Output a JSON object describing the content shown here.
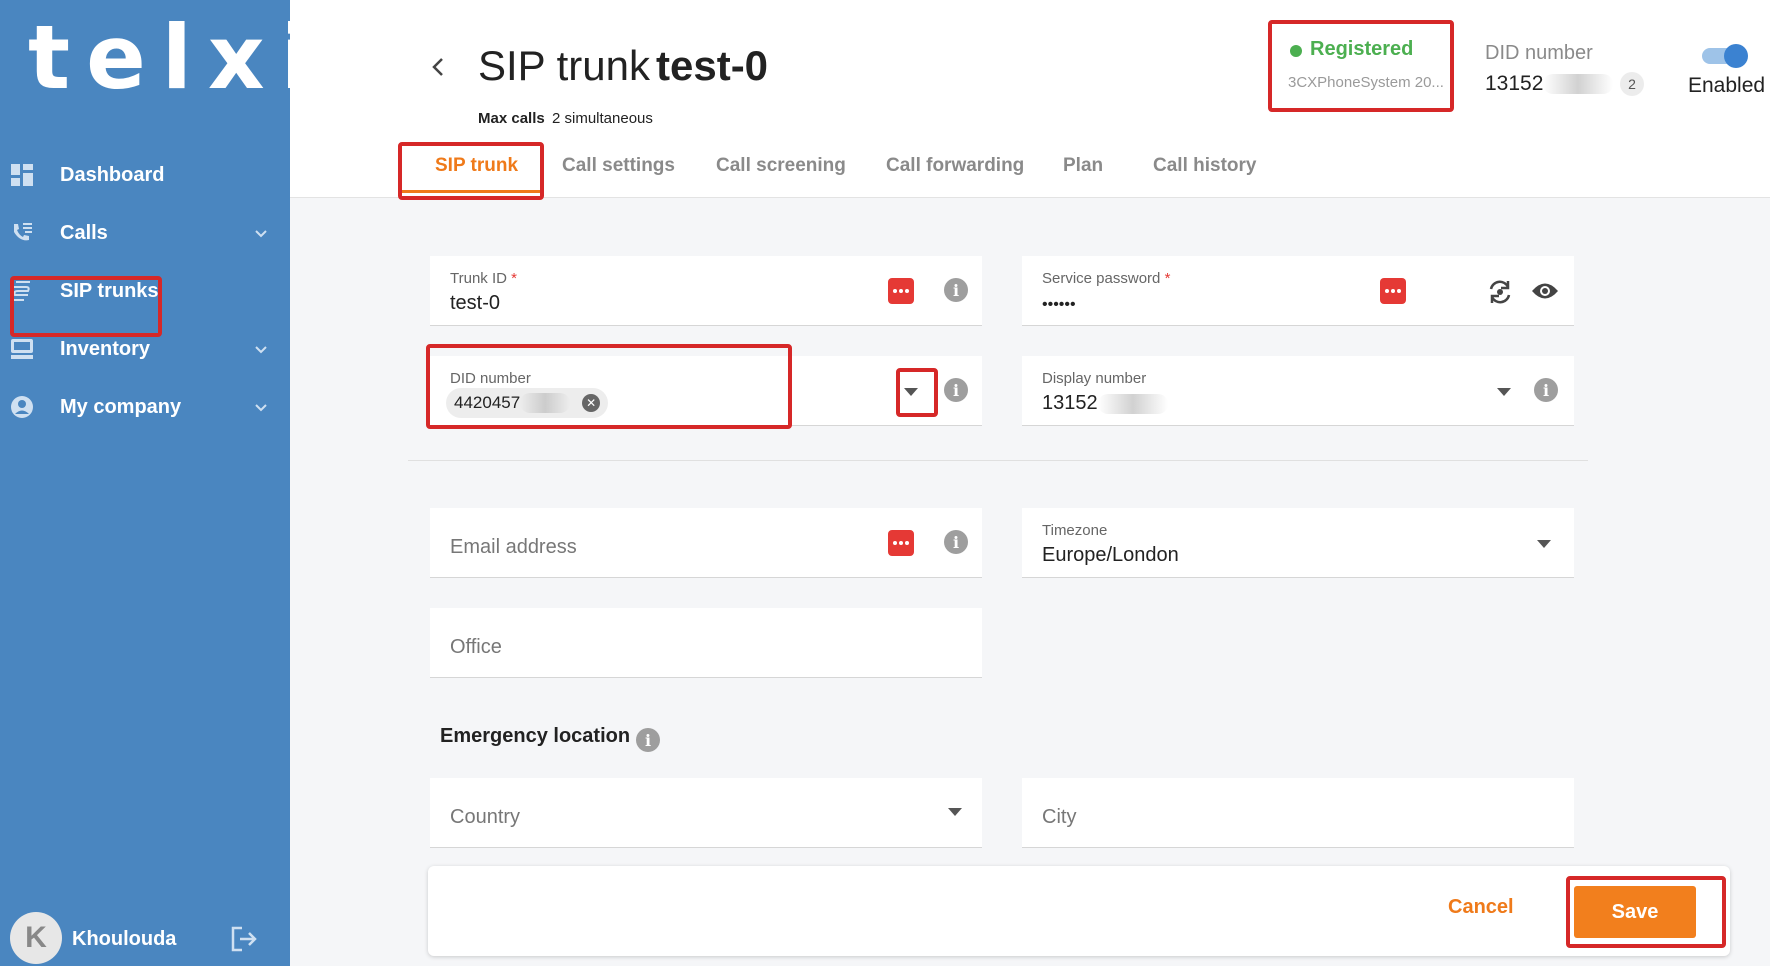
{
  "brand": {
    "logo_text": "telxi"
  },
  "sidebar": {
    "items": [
      {
        "label": "Dashboard",
        "icon": "dashboard-icon",
        "has_chevron": false
      },
      {
        "label": "Calls",
        "icon": "phone-list-icon",
        "has_chevron": true
      },
      {
        "label": "SIP trunks",
        "icon": "sip-trunk-icon",
        "has_chevron": false,
        "active": true
      },
      {
        "label": "Inventory",
        "icon": "inventory-icon",
        "has_chevron": true
      },
      {
        "label": "My company",
        "icon": "user-circle-icon",
        "has_chevron": true
      }
    ],
    "user": {
      "initial": "K",
      "name": "Khoulouda"
    }
  },
  "header": {
    "title_prefix": "SIP trunk",
    "title_name": "test-0",
    "max_calls_label": "Max calls",
    "max_calls_value": "2 simultaneous",
    "status": {
      "text": "Registered",
      "sub": "3CXPhoneSystem 20....",
      "color": "#4caf50"
    },
    "did": {
      "label": "DID number",
      "value": "13152",
      "count": "2"
    },
    "enabled_label": "Enabled",
    "enabled": true
  },
  "tabs": [
    {
      "label": "SIP trunk",
      "active": true
    },
    {
      "label": "Call settings"
    },
    {
      "label": "Call screening"
    },
    {
      "label": "Call forwarding"
    },
    {
      "label": "Plan"
    },
    {
      "label": "Call history"
    }
  ],
  "form": {
    "trunk_id": {
      "label": "Trunk ID",
      "required": "*",
      "value": "test-0"
    },
    "service_password": {
      "label": "Service password",
      "required": "*",
      "value": "••••••"
    },
    "did_number": {
      "label": "DID number",
      "chip": "4420457"
    },
    "display_number": {
      "label": "Display number",
      "value": "13152"
    },
    "email": {
      "placeholder": "Email address"
    },
    "timezone": {
      "label": "Timezone",
      "value": "Europe/London"
    },
    "office": {
      "placeholder": "Office"
    },
    "emergency_title": "Emergency location",
    "country": {
      "placeholder": "Country"
    },
    "city": {
      "placeholder": "City"
    }
  },
  "footer": {
    "cancel_label": "Cancel",
    "save_label": "Save"
  },
  "colors": {
    "sidebar": "#4a86c0",
    "accent": "#ef7a1a",
    "highlight": "#d62828",
    "error": "#e53935"
  }
}
